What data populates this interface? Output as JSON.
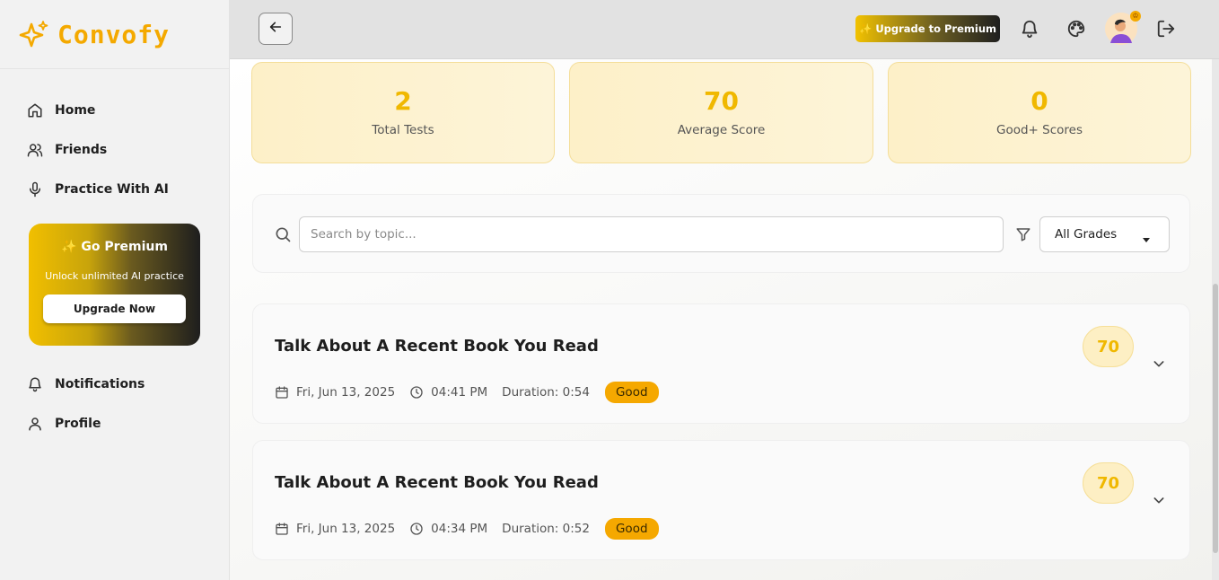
{
  "brand": {
    "name": "Convofy",
    "icon": "sparkle-icon",
    "color": "#f4a900"
  },
  "sidebar": {
    "items": [
      {
        "label": "Home",
        "icon": "home-icon"
      },
      {
        "label": "Friends",
        "icon": "users-icon"
      },
      {
        "label": "Practice With AI",
        "icon": "microphone-icon"
      }
    ],
    "premium": {
      "title": "✨ Go Premium",
      "subtitle": "Unlock unlimited AI practice",
      "button": "Upgrade Now"
    },
    "bottom_items": [
      {
        "label": "Notifications",
        "icon": "bell-icon"
      },
      {
        "label": "Profile",
        "icon": "user-icon"
      }
    ]
  },
  "topbar": {
    "upgrade_label": "✨ Upgrade to Premium",
    "icons": [
      "back-arrow-icon",
      "bell-icon",
      "palette-icon",
      "avatar",
      "logout-icon"
    ]
  },
  "stats": [
    {
      "value": "2",
      "label": "Total Tests"
    },
    {
      "value": "70",
      "label": "Average Score"
    },
    {
      "value": "0",
      "label": "Good+ Scores"
    }
  ],
  "filters": {
    "search_placeholder": "Search by topic...",
    "search_value": "",
    "grade_selected": "All Grades"
  },
  "tests": [
    {
      "title": "Talk About A Recent Book You Read",
      "date": "Fri, Jun 13, 2025",
      "time": "04:41 PM",
      "duration": "Duration: 0:54",
      "grade": "Good",
      "score": "70"
    },
    {
      "title": "Talk About A Recent Book You Read",
      "date": "Fri, Jun 13, 2025",
      "time": "04:34 PM",
      "duration": "Duration: 0:52",
      "grade": "Good",
      "score": "70"
    }
  ],
  "colors": {
    "accent": "#f0b800",
    "badge": "#f5a800",
    "stat_bg": "#fdf0c8"
  }
}
